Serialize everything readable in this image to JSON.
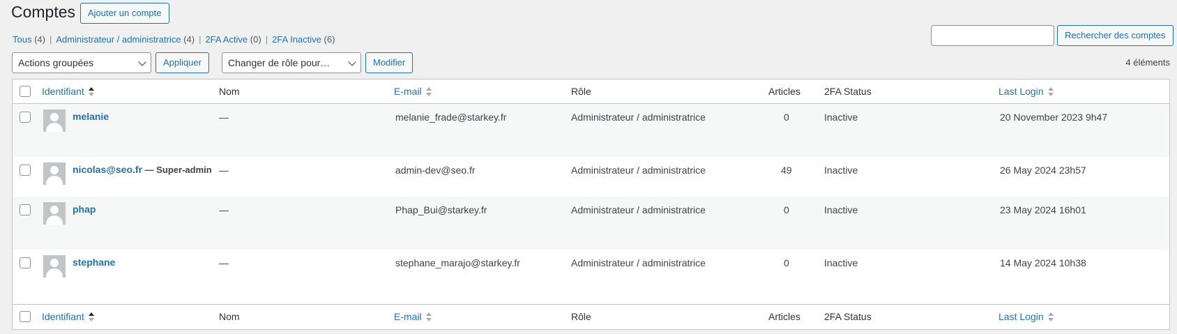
{
  "header": {
    "title": "Comptes",
    "add_button": "Ajouter un compte"
  },
  "filters": [
    {
      "label": "Tous",
      "count": "(4)"
    },
    {
      "label": "Administrateur / administratrice",
      "count": "(4)"
    },
    {
      "label": "2FA Active",
      "count": "(0)"
    },
    {
      "label": "2FA Inactive",
      "count": "(6)"
    }
  ],
  "search": {
    "value": "",
    "button": "Rechercher des comptes"
  },
  "bulk": {
    "actions_select": "Actions groupées",
    "apply_button": "Appliquer",
    "role_select": "Changer de rôle pour…",
    "modify_button": "Modifier",
    "item_count": "4 éléments"
  },
  "columns": {
    "username": "Identifiant",
    "name": "Nom",
    "email": "E-mail",
    "role": "Rôle",
    "posts": "Articles",
    "twofa": "2FA Status",
    "last_login": "Last Login"
  },
  "users": [
    {
      "username": "melanie",
      "state": "",
      "name": "—",
      "email": "melanie_frade@starkey.fr",
      "role": "Administrateur / administratrice",
      "posts": "0",
      "twofa": "Inactive",
      "last_login": "20 November 2023 9h47"
    },
    {
      "username": "nicolas@seo.fr",
      "state": " — Super-admin",
      "name": "—",
      "email": "admin-dev@seo.fr",
      "role": "Administrateur / administratrice",
      "posts": "49",
      "twofa": "Inactive",
      "last_login": "26 May 2024 23h57"
    },
    {
      "username": "phap",
      "state": "",
      "name": "—",
      "email": "Phap_Bui@starkey.fr",
      "role": "Administrateur / administratrice",
      "posts": "0",
      "twofa": "Inactive",
      "last_login": "23 May 2024 16h01"
    },
    {
      "username": "stephane",
      "state": "",
      "name": "—",
      "email": "stephane_marajo@starkey.fr",
      "role": "Administrateur / administratrice",
      "posts": "0",
      "twofa": "Inactive",
      "last_login": "14 May 2024 10h38"
    }
  ]
}
